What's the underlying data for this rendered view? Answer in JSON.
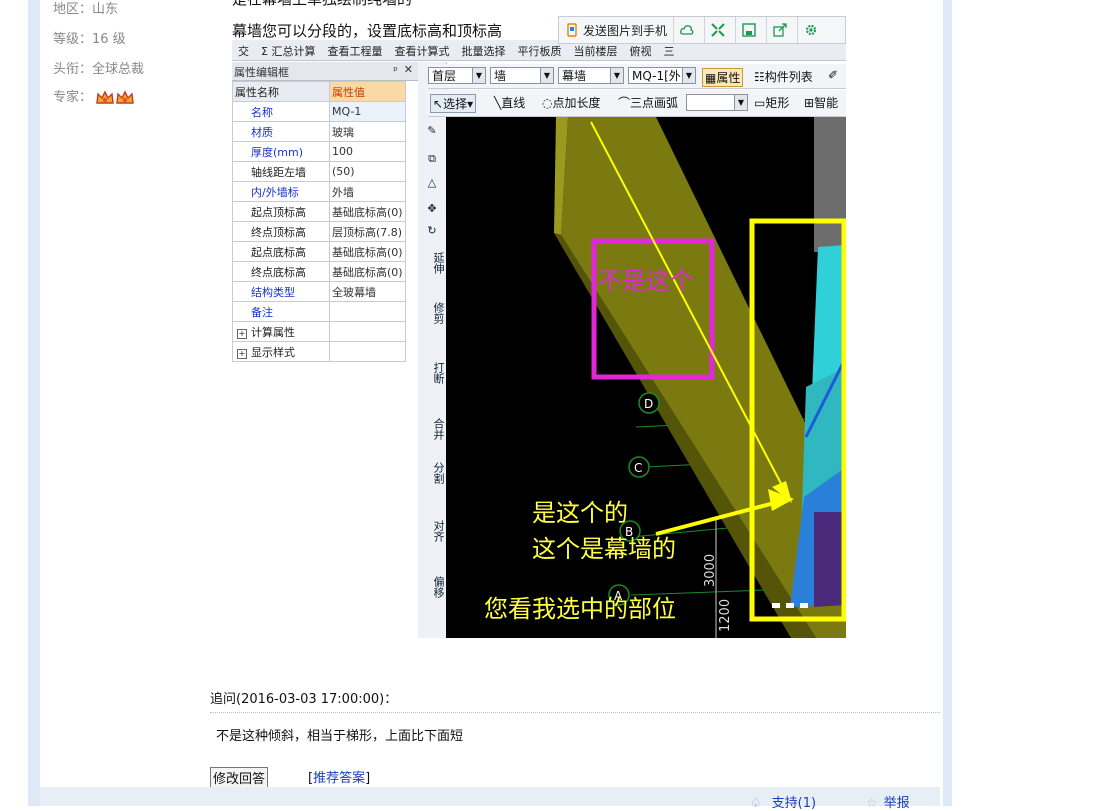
{
  "user_info": {
    "region": "地区：山东",
    "level": "等级：16 级",
    "title": "头衔：全球总裁",
    "expert_label": "专家："
  },
  "screenshot": {
    "caption_top": "是在幕墙上单独绘制纯墙的",
    "caption_line2": "幕墙您可以分段的，设置底标高和顶标高",
    "send_bar": {
      "send_to_phone": "发送图片到手机"
    },
    "toolbar_row": [
      "交",
      "Σ 汇总计算",
      "查看工程量",
      "查看计算式",
      "批量选择",
      "平行板质",
      "当前楼层",
      "俯视",
      "三"
    ],
    "selector_bar": {
      "floor": "首层",
      "category": "墙",
      "type": "幕墙",
      "component": "MQ-1[外",
      "property_btn": "属性",
      "component_list_btn": "构件列表"
    },
    "draw_bar": {
      "select": "选择",
      "line": "直线",
      "point_length": "点加长度",
      "three_point_arc": "三点画弧",
      "rect": "矩形",
      "smart": "智能"
    },
    "property_panel": {
      "title": "属性编辑框",
      "pin": "ᵖ",
      "close": "✕",
      "header_name": "属性名称",
      "header_value": "属性值",
      "rows": [
        {
          "name": "名称",
          "value": "MQ-1",
          "blue": true
        },
        {
          "name": "材质",
          "value": "玻璃",
          "blue": true
        },
        {
          "name": "厚度(mm)",
          "value": "100",
          "blue": true
        },
        {
          "name": "轴线距左墙",
          "value": "(50)",
          "blue": false
        },
        {
          "name": "内/外墙标",
          "value": "外墙",
          "blue": true
        },
        {
          "name": "起点顶标高",
          "value": "基础底标高(0)",
          "blue": false
        },
        {
          "name": "终点顶标高",
          "value": "层顶标高(7.8)",
          "blue": false
        },
        {
          "name": "起点底标高",
          "value": "基础底标高(0)",
          "blue": false
        },
        {
          "name": "终点底标高",
          "value": "基础底标高(0)",
          "blue": false
        },
        {
          "name": "结构类型",
          "value": "全玻幕墙",
          "blue": true
        },
        {
          "name": "备注",
          "value": "",
          "blue": true
        }
      ],
      "groups": [
        "计算属性",
        "显示样式"
      ]
    },
    "tool_strip": [
      "延伸",
      "修剪",
      "打断",
      "合并",
      "分割",
      "对齐",
      "偏移"
    ],
    "annotations": {
      "not_this": "不是这个",
      "is_this_1": "是这个的",
      "is_this_2": "这个是幕墙的",
      "selected": "您看我选中的部位"
    },
    "axis_labels": [
      "D",
      "C",
      "B",
      "A"
    ],
    "dimensions": [
      "3000",
      "1200"
    ]
  },
  "followup": {
    "header": "追问(2016-03-03 17:00:00)：",
    "text": "不是这种倾斜，相当于梯形，上面比下面短"
  },
  "actions": {
    "edit_answer": "修改回答",
    "recommend_open": "[",
    "recommend": "推荐答案",
    "recommend_close": "]",
    "support": "支持(1)",
    "report": "举报"
  },
  "colors": {
    "magenta_box": "#e028d8",
    "yellow_box": "#ffff00",
    "olive_wall": "#7a7a10",
    "curtain_blue": "#2a7fd8",
    "curtain_cyan": "#30d0d8",
    "link_blue": "#1a3dbb"
  }
}
